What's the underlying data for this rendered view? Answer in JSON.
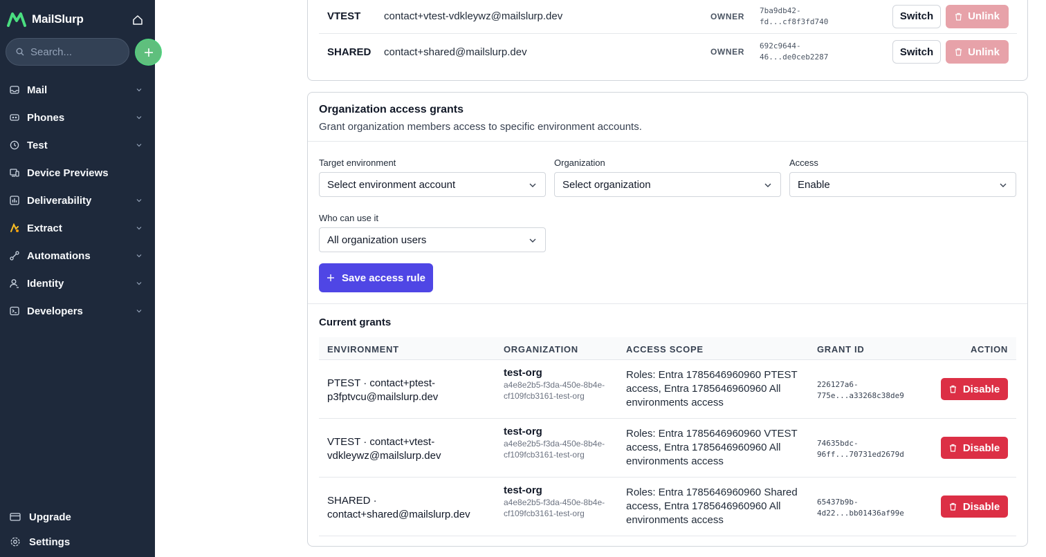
{
  "sidebar": {
    "brand": "MailSlurp",
    "search_placeholder": "Search...",
    "items": [
      {
        "label": "Mail",
        "icon": "inbox-icon"
      },
      {
        "label": "Phones",
        "icon": "phone-icon"
      },
      {
        "label": "Test",
        "icon": "clock-icon"
      },
      {
        "label": "Device Previews",
        "icon": "device-icon"
      },
      {
        "label": "Deliverability",
        "icon": "chart-icon"
      },
      {
        "label": "Extract",
        "icon": "extract-icon"
      },
      {
        "label": "Automations",
        "icon": "automation-icon"
      },
      {
        "label": "Identity",
        "icon": "user-icon"
      },
      {
        "label": "Developers",
        "icon": "terminal-icon"
      }
    ],
    "bottom": [
      {
        "label": "Upgrade",
        "icon": "card-icon"
      },
      {
        "label": "Settings",
        "icon": "gear-icon"
      }
    ]
  },
  "environments": [
    {
      "name": "VTEST",
      "email": "contact+vtest-vdkleywz@mailslurp.dev",
      "role": "OWNER",
      "id_line1": "7ba9db42-",
      "id_line2": "fd...cf8f3fd740",
      "switch": "Switch",
      "unlink": "Unlink"
    },
    {
      "name": "SHARED",
      "email": "contact+shared@mailslurp.dev",
      "role": "OWNER",
      "id_line1": "692c9644-",
      "id_line2": "46...de0ceb2287",
      "switch": "Switch",
      "unlink": "Unlink"
    }
  ],
  "grants_card": {
    "title": "Organization access grants",
    "subtitle": "Grant organization members access to specific environment accounts.",
    "fields": {
      "target_label": "Target environment",
      "target_value": "Select environment account",
      "org_label": "Organization",
      "org_value": "Select organization",
      "access_label": "Access",
      "access_value": "Enable",
      "who_label": "Who can use it",
      "who_value": "All organization users"
    },
    "save_label": "Save access rule",
    "current_title": "Current grants",
    "columns": [
      "ENVIRONMENT",
      "ORGANIZATION",
      "ACCESS SCOPE",
      "GRANT ID",
      "ACTION"
    ],
    "rows": [
      {
        "env": "PTEST · contact+ptest-p3fptvcu@mailslurp.dev",
        "org_name": "test-org",
        "org_id": "a4e8e2b5-f3da-450e-8b4e-cf109fcb3161-test-org",
        "scope": "Roles: Entra 1785646960960 PTEST access, Entra 1785646960960 All environments access",
        "gid1": "226127a6-",
        "gid2": "775e...a33268c38de9",
        "action": "Disable"
      },
      {
        "env": "VTEST · contact+vtest-vdkleywz@mailslurp.dev",
        "org_name": "test-org",
        "org_id": "a4e8e2b5-f3da-450e-8b4e-cf109fcb3161-test-org",
        "scope": "Roles: Entra 1785646960960 VTEST access, Entra 1785646960960 All environments access",
        "gid1": "74635bdc-",
        "gid2": "96ff...70731ed2679d",
        "action": "Disable"
      },
      {
        "env": "SHARED · contact+shared@mailslurp.dev",
        "org_name": "test-org",
        "org_id": "a4e8e2b5-f3da-450e-8b4e-cf109fcb3161-test-org",
        "scope": "Roles: Entra 1785646960960 Shared access, Entra 1785646960960 All environments access",
        "gid1": "65437b9b-",
        "gid2": "4d22...bb01436af99e",
        "action": "Disable"
      }
    ]
  },
  "colors": {
    "sidebar_bg": "#1e293b",
    "primary": "#4f46e5",
    "danger": "#dc2f45",
    "danger_disabled": "#e7a2a9",
    "add_button": "#5fbf7d"
  }
}
